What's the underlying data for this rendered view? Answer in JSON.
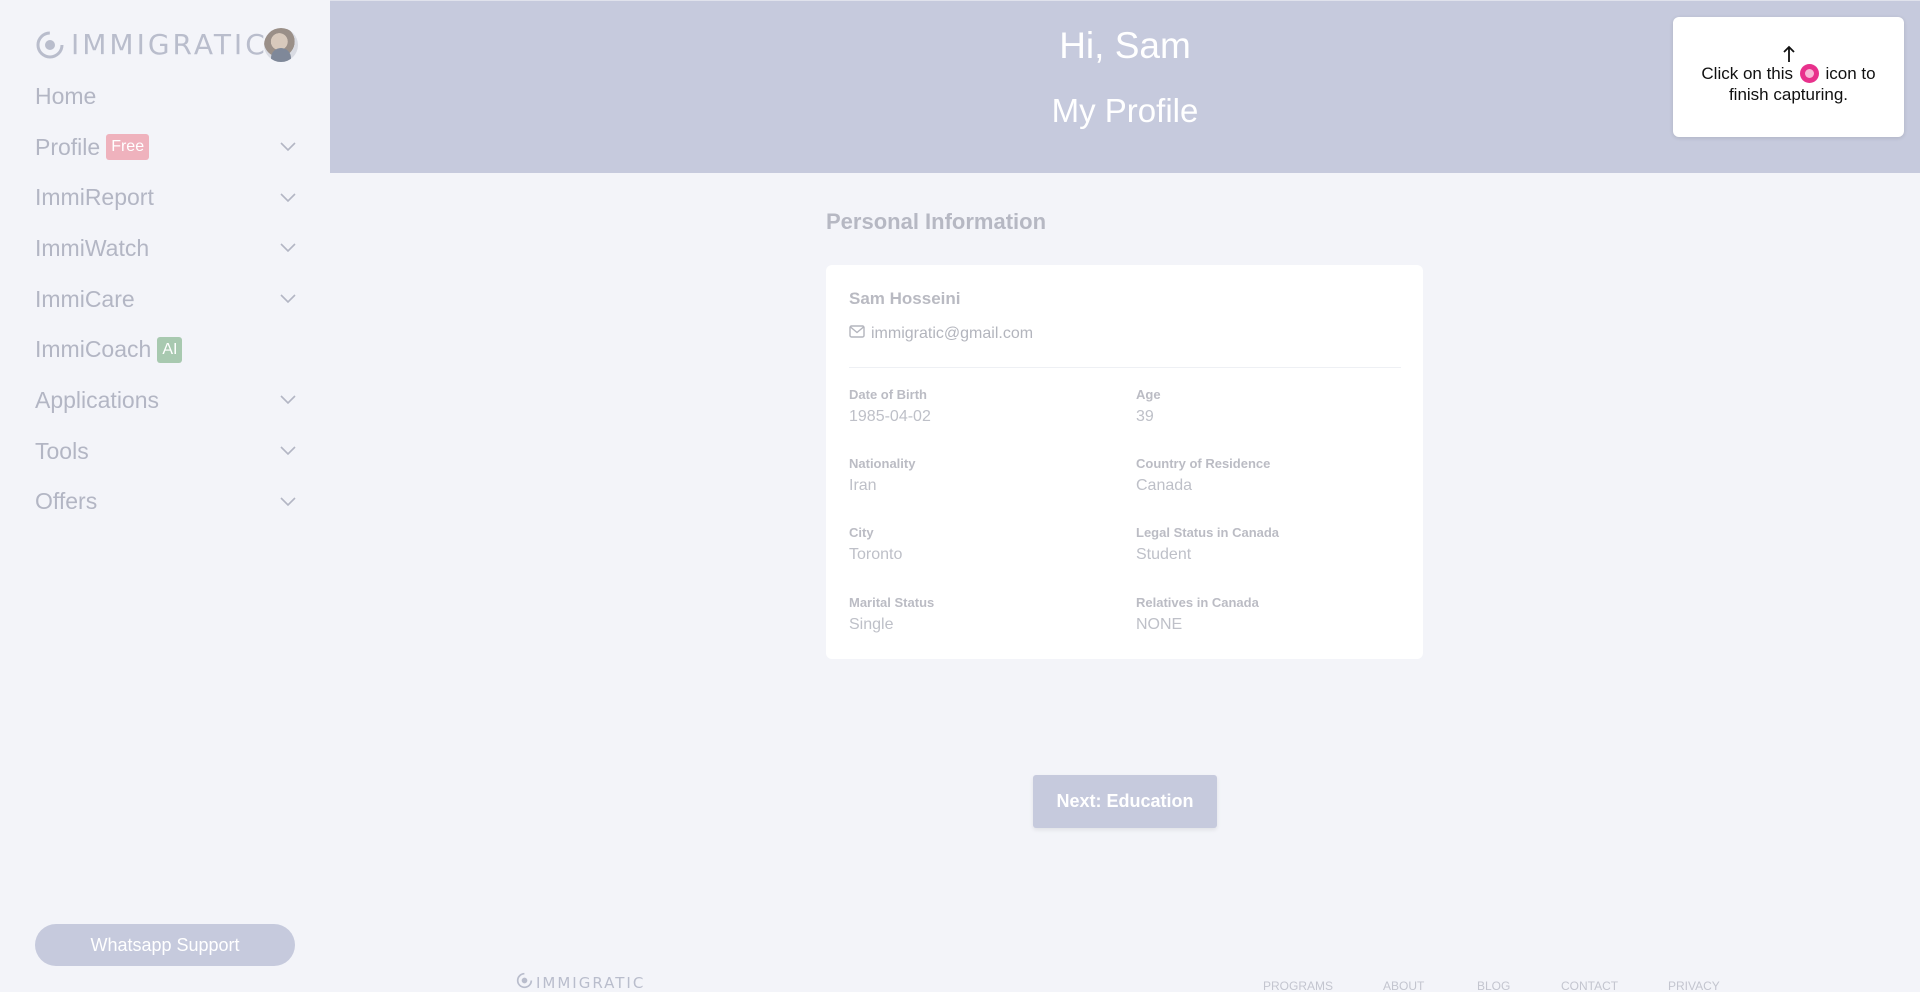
{
  "brand": {
    "name": "IMMIGRATIC"
  },
  "sidebar": {
    "items": [
      {
        "label": "Home",
        "badge": "",
        "has_chevron": false
      },
      {
        "label": "Profile",
        "badge": "Free",
        "has_chevron": true
      },
      {
        "label": "ImmiReport",
        "badge": "",
        "has_chevron": true
      },
      {
        "label": "ImmiWatch",
        "badge": "",
        "has_chevron": true
      },
      {
        "label": "ImmiCare",
        "badge": "",
        "has_chevron": true
      },
      {
        "label": "ImmiCoach",
        "badge": "AI",
        "has_chevron": false
      },
      {
        "label": "Applications",
        "badge": "",
        "has_chevron": true
      },
      {
        "label": "Tools",
        "badge": "",
        "has_chevron": true
      },
      {
        "label": "Offers",
        "badge": "",
        "has_chevron": true
      }
    ],
    "whatsapp_label": "Whatsapp Support"
  },
  "header": {
    "greeting": "Hi, Sam",
    "title": "My Profile"
  },
  "tooltip": {
    "text_before": "Click on this",
    "text_after": "icon to finish capturing."
  },
  "profile": {
    "section_title": "Personal Information",
    "name": "Sam Hosseini",
    "email": "immigratic@gmail.com",
    "fields": {
      "dob": {
        "label": "Date of Birth",
        "value": "1985-04-02"
      },
      "age": {
        "label": "Age",
        "value": "39"
      },
      "nationality": {
        "label": "Nationality",
        "value": "Iran"
      },
      "residence": {
        "label": "Country of Residence",
        "value": "Canada"
      },
      "city": {
        "label": "City",
        "value": "Toronto"
      },
      "legal": {
        "label": "Legal Status in Canada",
        "value": "Student"
      },
      "marital": {
        "label": "Marital Status",
        "value": "Single"
      },
      "relatives": {
        "label": "Relatives in Canada",
        "value": "NONE"
      }
    }
  },
  "next_button": "Next: Education",
  "footer": {
    "brand": "IMMIGRATIC",
    "links": [
      "PROGRAMS",
      "ABOUT",
      "BLOG",
      "CONTACT",
      "PRIVACY"
    ]
  },
  "colors": {
    "header_bg": "#c6cadd",
    "page_bg": "#f3f4f9",
    "free_badge": "#efb2bd",
    "ai_badge": "#a8c9b0",
    "record_icon": "#e8318c"
  },
  "icons": [
    "logo-mark-icon",
    "chevron-down-icon",
    "mail-icon",
    "arrow-up-icon",
    "record-icon"
  ]
}
